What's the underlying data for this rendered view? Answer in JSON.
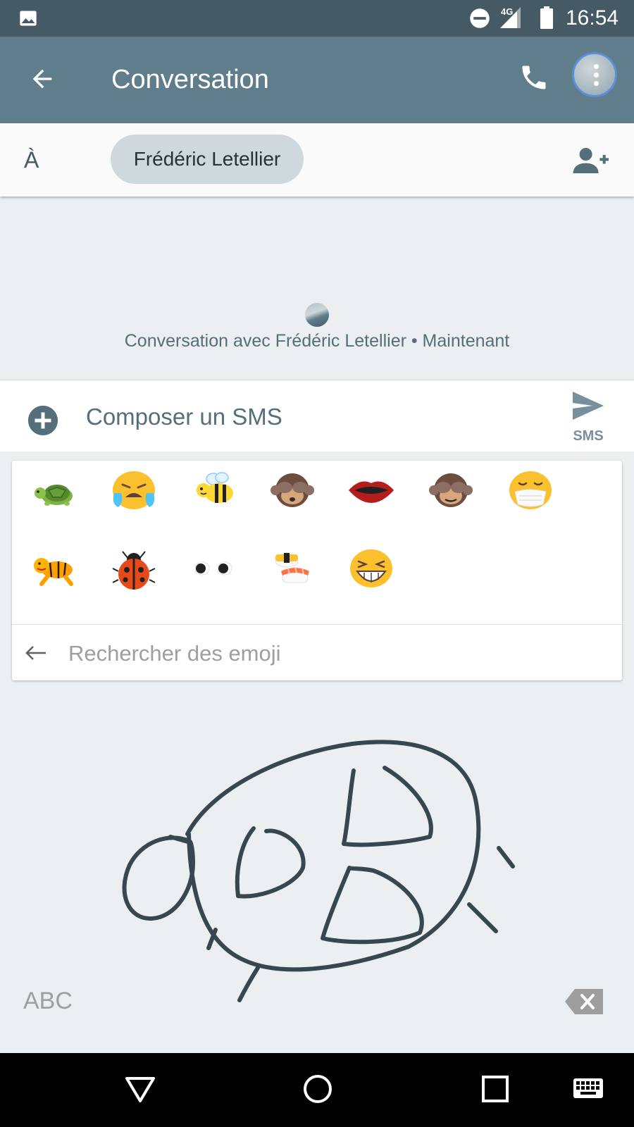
{
  "status_bar": {
    "time": "16:54",
    "network": "4G",
    "icons": [
      "image-icon",
      "dnd-icon",
      "signal-icon",
      "battery-icon"
    ]
  },
  "app_bar": {
    "title": "Conversation",
    "icons": [
      "back-arrow-icon",
      "phone-icon",
      "avatar"
    ]
  },
  "recipient_bar": {
    "to_label": "À",
    "recipient": "Frédéric Letellier",
    "icon": "add-person-icon"
  },
  "conversation": {
    "info": "Conversation avec Frédéric Letellier • Maintenant"
  },
  "compose": {
    "placeholder": "Composer un SMS",
    "send_label": "SMS",
    "icons": [
      "add-circle-icon",
      "send-icon"
    ]
  },
  "emoji_panel": {
    "row1": [
      "turtle",
      "loudly-crying-face",
      "bee",
      "see-no-evil-monkey",
      "mouth",
      "see-no-evil-monkey-2",
      "face-with-medical-mask"
    ],
    "row2": [
      "tiger",
      "lady-beetle",
      "eyes",
      "sushi",
      "grinning-squinting-face"
    ],
    "search_placeholder": "Rechercher des emoji"
  },
  "keyboard": {
    "mode_label": "ABC",
    "icons": [
      "backspace-icon"
    ]
  },
  "nav_bar": {
    "icons": [
      "back-triangle-icon",
      "home-circle-icon",
      "recents-square-icon",
      "keyboard-icon"
    ]
  },
  "colors": {
    "status_bar": "#455a64",
    "app_bar": "#607d8b",
    "chip": "#cfd8dc",
    "background": "#eceff1",
    "ink": "#37474f"
  }
}
